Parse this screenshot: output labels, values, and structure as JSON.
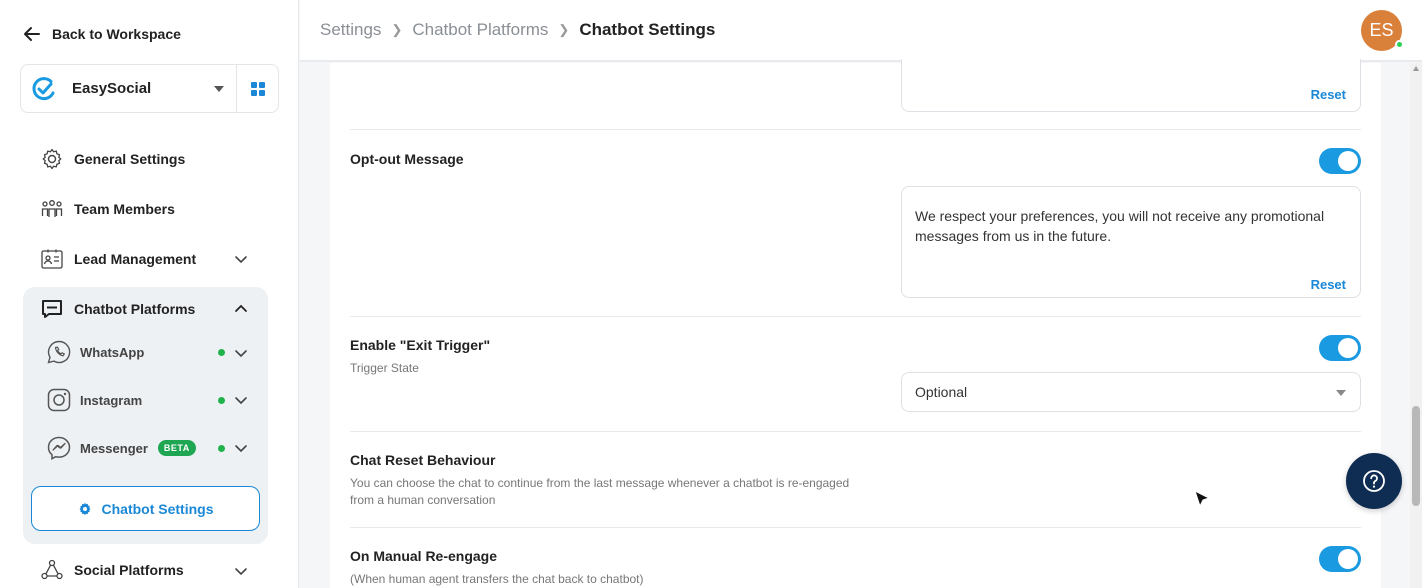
{
  "sidebar": {
    "back_label": "Back to Workspace",
    "workspace_name": "EasySocial",
    "nav": {
      "general": "General Settings",
      "team": "Team Members",
      "lead": "Lead Management",
      "chatbot": "Chatbot Platforms",
      "social": "Social Platforms"
    },
    "sub": {
      "whatsapp": "WhatsApp",
      "instagram": "Instagram",
      "messenger": "Messenger",
      "messenger_badge": "BETA"
    },
    "chatbot_settings": "Chatbot Settings"
  },
  "breadcrumb": {
    "items": [
      "Settings",
      "Chatbot Platforms",
      "Chatbot Settings"
    ]
  },
  "user": {
    "initials": "ES"
  },
  "sections": {
    "top": {
      "reset": "Reset"
    },
    "optout": {
      "title": "Opt-out Message",
      "enabled": true,
      "message": "We respect your preferences, you will not receive any promotional messages from us in the future.",
      "reset": "Reset"
    },
    "exit": {
      "title": "Enable \"Exit Trigger\"",
      "subtitle": "Trigger State",
      "enabled": true,
      "value": "Optional"
    },
    "reset_behaviour": {
      "title": "Chat Reset Behaviour",
      "description": "You can choose the chat to continue from the last message whenever a chatbot is re-engaged from a human conversation"
    },
    "manual": {
      "title": "On Manual Re-engage",
      "subtitle": "(When human agent transfers the chat back to chatbot)",
      "enabled": true
    }
  },
  "colors": {
    "accent": "#1a88d6",
    "toggle": "#1a9ae0",
    "avatar": "#d9803b",
    "online": "#22b24c",
    "help": "#0f2d52"
  }
}
